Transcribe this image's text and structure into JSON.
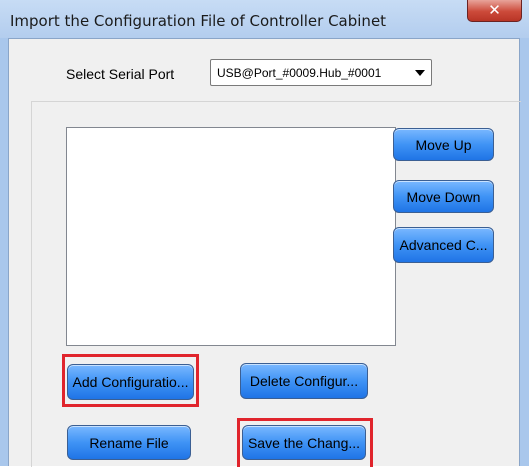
{
  "window": {
    "title": "Import the Configuration File of Controller Cabinet",
    "close_glyph": "✕"
  },
  "serial_port": {
    "label": "Select Serial Port",
    "selected": "USB@Port_#0009.Hub_#0001"
  },
  "config_files": [],
  "buttons": {
    "move_up": "Move Up",
    "move_down": "Move Down",
    "advanced": "Advanced C...",
    "add_configuration": "Add Configuratio...",
    "delete_configuration": "Delete Configur...",
    "rename_file": "Rename File",
    "save_changes": "Save the Chang..."
  },
  "highlight_color": "#e0242c"
}
